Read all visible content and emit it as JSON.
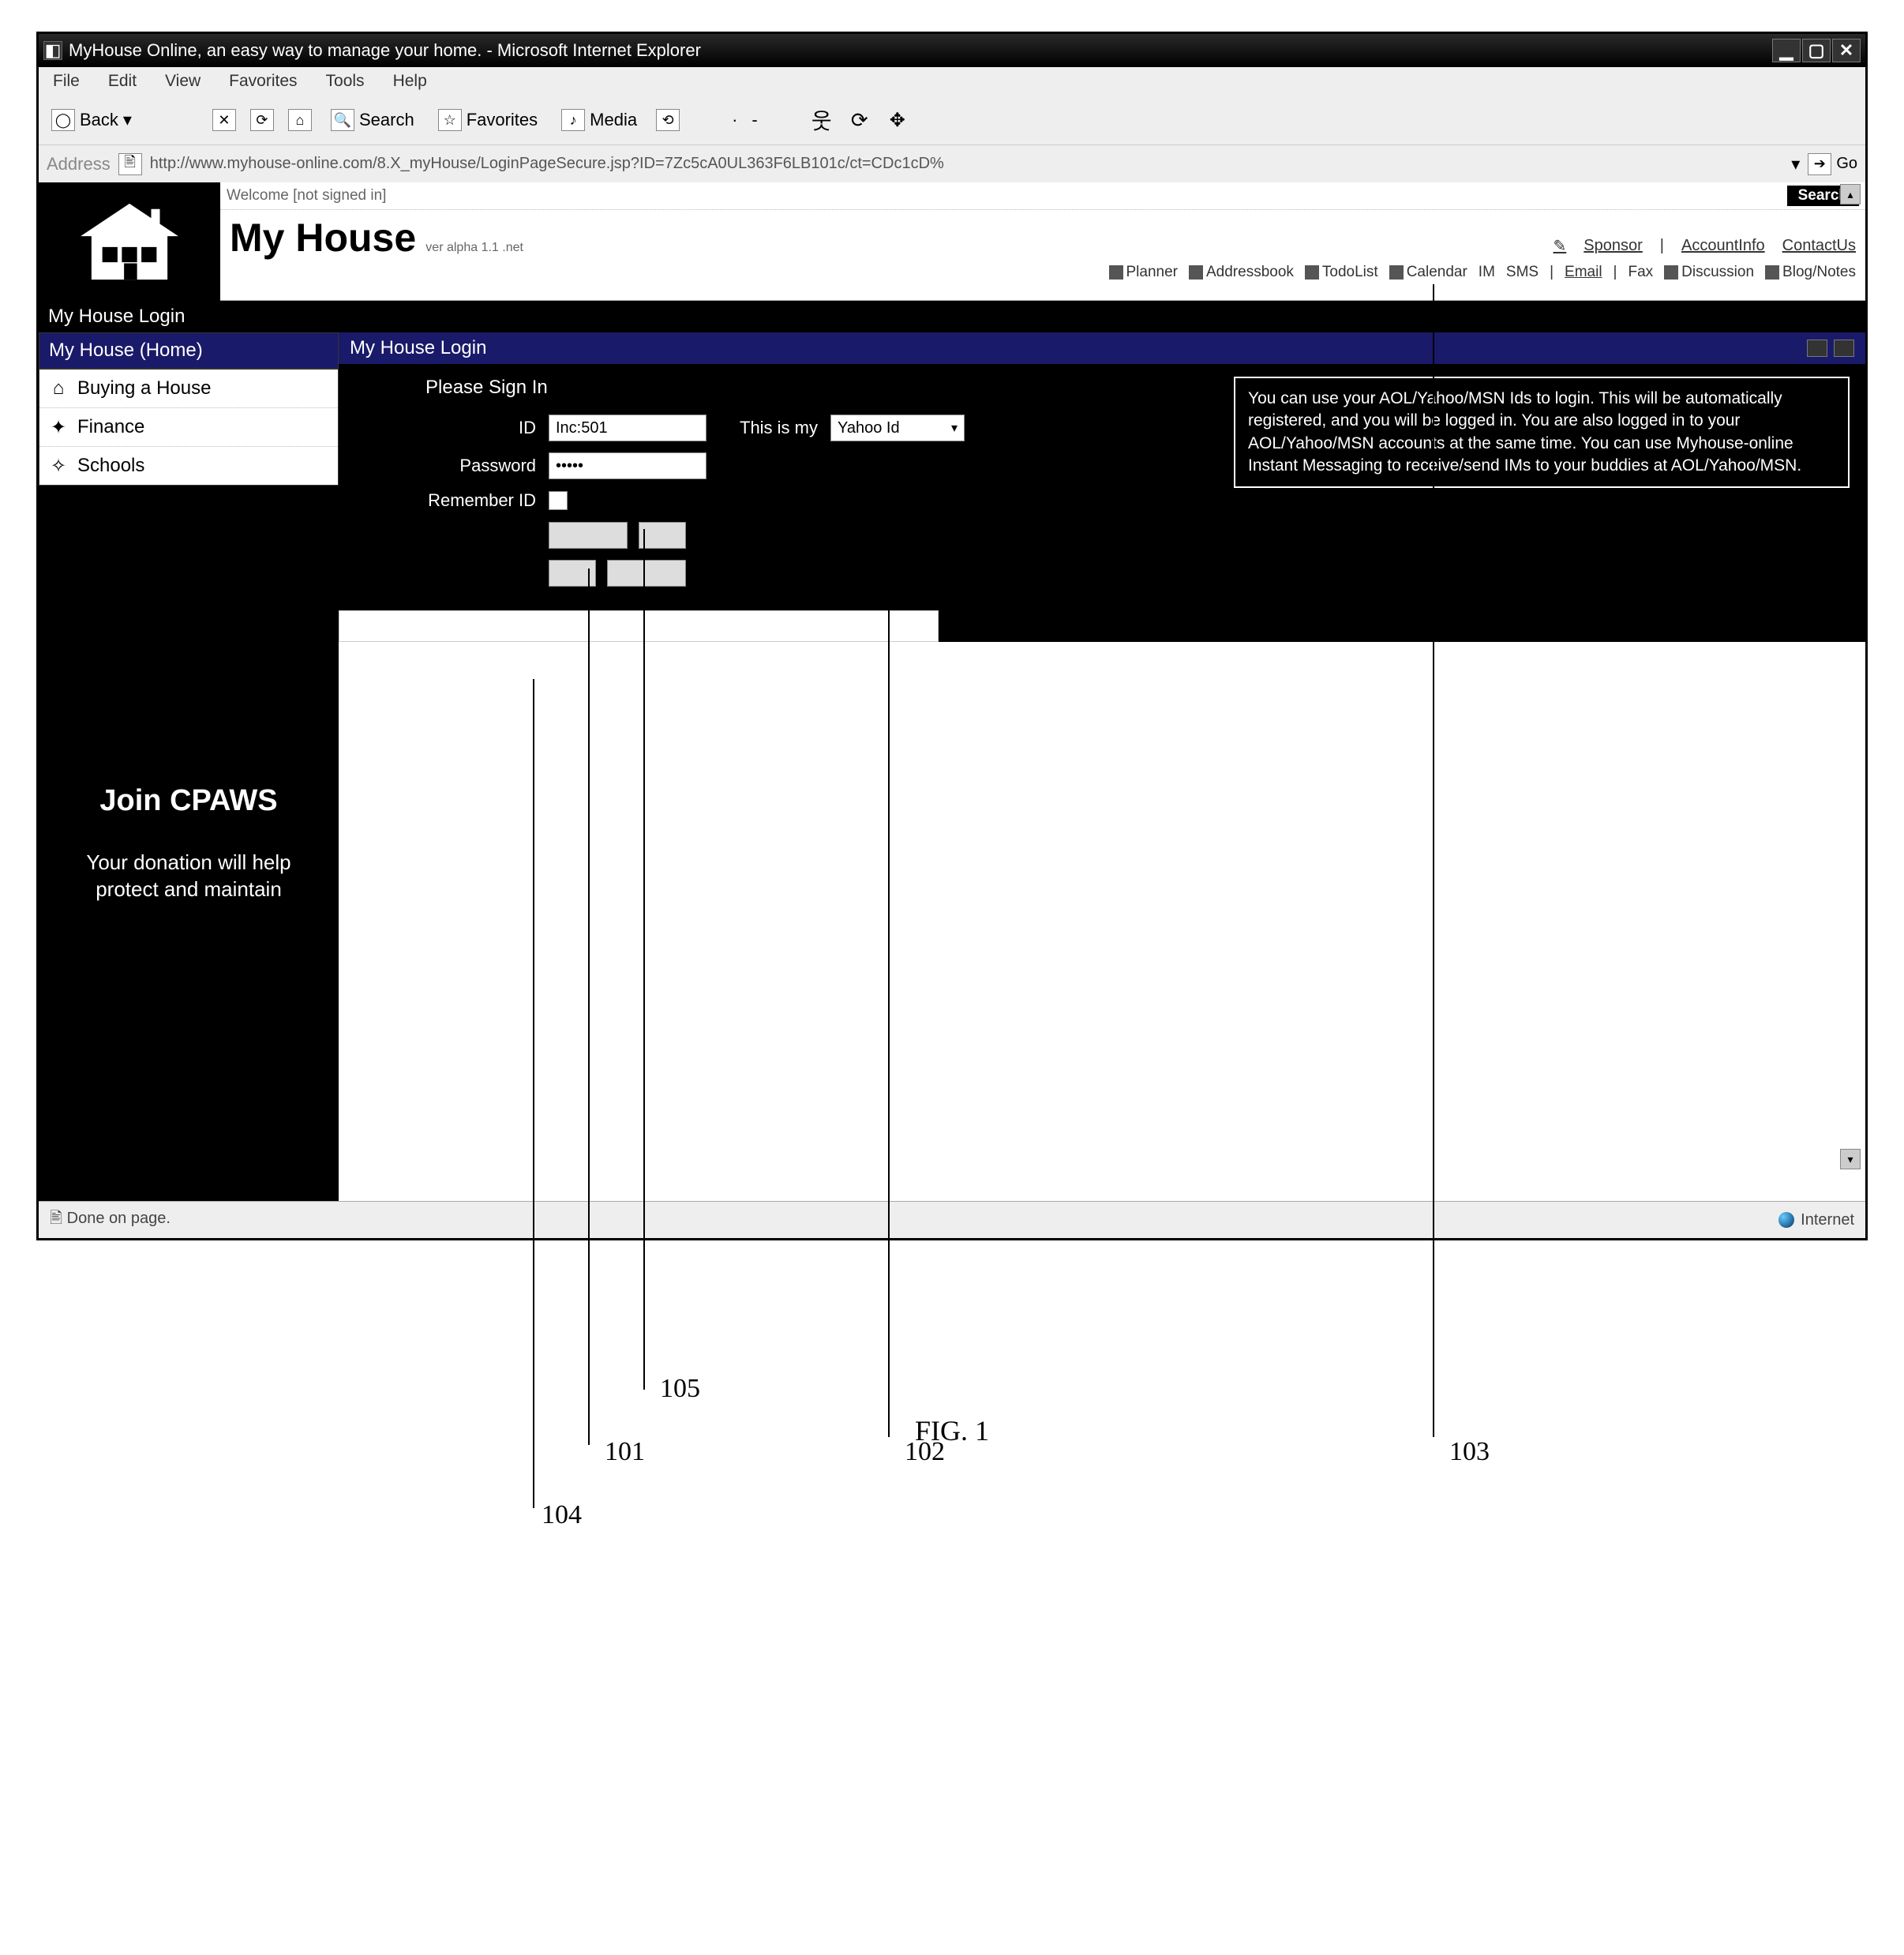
{
  "window": {
    "title": "MyHouse Online, an easy way to manage your home. - Microsoft Internet Explorer",
    "menus": [
      "File",
      "Edit",
      "View",
      "Favorites",
      "Tools",
      "Help"
    ],
    "toolbar": {
      "back": "Back",
      "search": "Search",
      "favorites": "Favorites",
      "media": "Media"
    },
    "address_label": "Address",
    "address_url": "http://www.myhouse-online.com/8.X_myHouse/LoginPageSecure.jsp?ID=7Zc5cA0UL363F6LB101c/ct=CDc1cD%",
    "go_label": "Go"
  },
  "header": {
    "welcome": "Welcome [not signed in]",
    "search_button": "Search",
    "brand": "My House",
    "brand_suffix": "ver alpha 1.1 .net",
    "links": {
      "sponsor": "Sponsor",
      "account": "AccountInfo",
      "contact": "ContactUs"
    },
    "features": {
      "planner": "Planner",
      "addressbook": "Addressbook",
      "todolist": "TodoList",
      "calendar": "Calendar",
      "im": "IM",
      "sms": "SMS",
      "email": "Email",
      "fax": "Fax",
      "discussion": "Discussion",
      "blog": "Blog/Notes"
    }
  },
  "page_title_bar": "My House Login",
  "sidebar": {
    "tab": "My House (Home)",
    "items": [
      "Buying a House",
      "Finance",
      "Schools"
    ],
    "promo_title": "Join CPAWS",
    "promo_text": "Your donation will help protect and maintain"
  },
  "login_panel": {
    "title": "My House Login",
    "heading": "Please Sign In",
    "id_label": "ID",
    "id_value": "Inc:501",
    "password_label": "Password",
    "password_value": "•••••",
    "remember_label": "Remember ID",
    "this_is_my": "This is my",
    "select_value": "Yahoo Id",
    "buttons": {
      "b1": "",
      "b2": "",
      "b3": "",
      "b4": ""
    },
    "info": "You can use your AOL/Yahoo/MSN Ids to login. This will be automatically registered, and you will be logged in. You are also logged in to your AOL/Yahoo/MSN accounts at the same time. You can use Myhouse-online Instant Messaging to receive/send IMs to your buddies at AOL/Yahoo/MSN."
  },
  "statusbar": {
    "left": "Done on page.",
    "right": "Internet"
  },
  "annotations": {
    "a101": "101",
    "a102": "102",
    "a103": "103",
    "a104": "104",
    "a105": "105"
  },
  "figure_caption": "FIG. 1"
}
